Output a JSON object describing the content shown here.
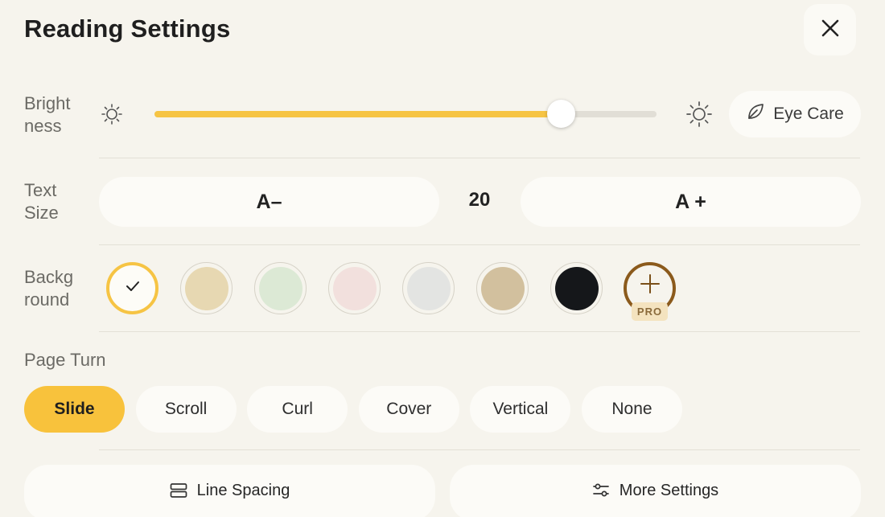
{
  "header": {
    "title": "Reading Settings",
    "close_icon": "close-icon"
  },
  "brightness": {
    "label": "Bright ness",
    "level": 0.81,
    "min_icon": "sun-small-icon",
    "max_icon": "sun-large-icon",
    "eye_care_label": "Eye Care",
    "eye_care_icon": "leaf-icon",
    "fill_color": "#f6c444"
  },
  "text_size": {
    "label": "Text Size",
    "decrease_label": "A–",
    "increase_label": "A +",
    "value": "20"
  },
  "background": {
    "label": "Backg round",
    "selected_index": 0,
    "swatches": [
      {
        "color": "#fdfcf7",
        "selected": true
      },
      {
        "color": "#e7d8b2"
      },
      {
        "color": "#dce9d5"
      },
      {
        "color": "#f2e0dd"
      },
      {
        "color": "#e3e4e2"
      },
      {
        "color": "#d2c09e"
      },
      {
        "color": "#15171a"
      }
    ],
    "add_icon": "plus-icon",
    "pro_badge": "PRO",
    "accent_color": "#f6c444"
  },
  "page_turn": {
    "label": "Page Turn",
    "options": [
      "Slide",
      "Scroll",
      "Curl",
      "Cover",
      "Vertical",
      "None"
    ],
    "selected": "Slide",
    "active_color": "#f8c23c"
  },
  "footer": {
    "line_spacing_label": "Line Spacing",
    "line_spacing_icon": "line-spacing-icon",
    "more_settings_label": "More Settings",
    "more_settings_icon": "sliders-icon"
  }
}
